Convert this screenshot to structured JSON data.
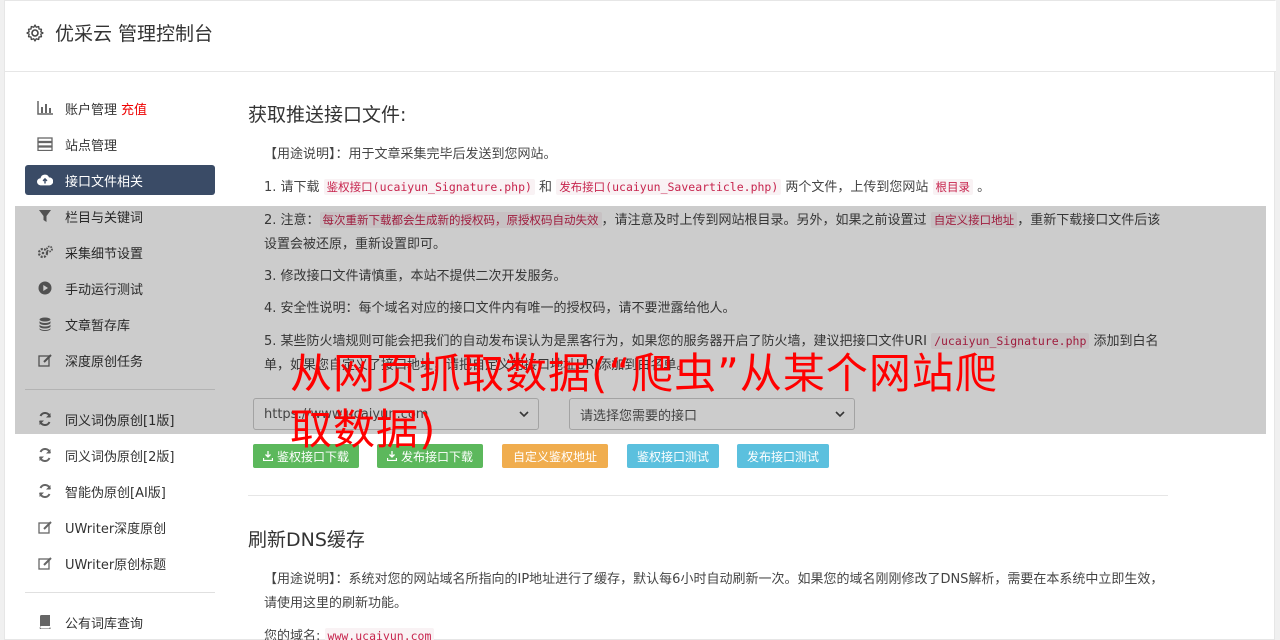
{
  "header": {
    "title": "优采云 管理控制台"
  },
  "sidebar": {
    "group1": [
      {
        "label": "账户管理",
        "badge": "充值",
        "icon": "bar-chart-icon"
      },
      {
        "label": "站点管理",
        "icon": "server-icon"
      },
      {
        "label": "接口文件相关",
        "icon": "cloud-upload-icon",
        "active": true
      },
      {
        "label": "栏目与关键词",
        "icon": "filter-icon"
      },
      {
        "label": "采集细节设置",
        "icon": "gears-icon"
      },
      {
        "label": "手动运行测试",
        "icon": "play-circle-icon"
      },
      {
        "label": "文章暂存库",
        "icon": "database-icon"
      },
      {
        "label": "深度原创任务",
        "icon": "edit-icon"
      }
    ],
    "group2": [
      {
        "label": "同义词伪原创[1版]",
        "icon": "refresh-icon"
      },
      {
        "label": "同义词伪原创[2版]",
        "icon": "refresh-icon"
      },
      {
        "label": "智能伪原创[AI版]",
        "icon": "refresh-icon"
      },
      {
        "label": "UWriter深度原创",
        "icon": "edit-icon"
      },
      {
        "label": "UWriter原创标题",
        "icon": "edit-icon"
      }
    ],
    "group3": [
      {
        "label": "公有词库查询",
        "icon": "book-icon"
      }
    ]
  },
  "section1": {
    "title": "获取推送接口文件:",
    "usage": "【用途说明】：用于文章采集完毕后发送到您网站。",
    "step1_a": "1. 请下载 ",
    "step1_code1": "鉴权接口(ucaiyun_Signature.php)",
    "step1_b": " 和 ",
    "step1_code2": "发布接口(ucaiyun_Savearticle.php)",
    "step1_c": " 两个文件，上传到您网站 ",
    "step1_code3": "根目录",
    "step1_d": " 。",
    "step2_a": "2. 注意：",
    "step2_code1": "每次重新下载都会生成新的授权码，原授权码自动失效",
    "step2_b": "，请注意及时上传到网站根目录。另外，如果之前设置过 ",
    "step2_code2": "自定义接口地址",
    "step2_c": "，重新下载接口文件后该设置会被还原，重新设置即可。",
    "step3": "3. 修改接口文件请慎重，本站不提供二次开发服务。",
    "step4": "4. 安全性说明：每个域名对应的接口文件内有唯一的授权码，请不要泄露给他人。",
    "step5_a": "5. 某些防火墙规则可能会把我们的自动发布误认为是黑客行为，如果您的服务器开启了防火墙，建议把接口文件URI ",
    "step5_code": "/ucaiyun_Signature.php",
    "step5_b": " 添加到白名单，如果您自定义了接口地址，请把自定义的接口地址URI添加到白名单。",
    "site_select": "https://www.ucaiyun.com",
    "api_select": "请选择您需要的接口",
    "buttons": {
      "auth_download": "鉴权接口下载",
      "publish_download": "发布接口下载",
      "custom_auth": "自定义鉴权地址",
      "auth_test": "鉴权接口测试",
      "publish_test": "发布接口测试"
    }
  },
  "section2": {
    "title": "刷新DNS缓存",
    "usage": "【用途说明】：系统对您的网站域名所指向的IP地址进行了缓存，默认每6小时自动刷新一次。如果您的域名刚刚修改了DNS解析，需要在本系统中立即生效，请使用这里的刷新功能。",
    "domain_label": "您的域名:",
    "domain_value": "www.ucaiyun.com"
  },
  "watermark": "从网页抓取数据(“爬虫”从某个网站爬取数据)",
  "colors": {
    "active_nav": "#3a4b66",
    "green": "#5cb85c",
    "orange": "#f0ad4e",
    "blue": "#5bc0de",
    "code": "#c7254e",
    "watermark": "#ff0000"
  }
}
